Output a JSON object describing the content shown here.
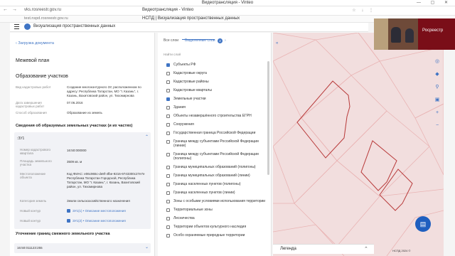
{
  "window": {
    "title": "Видеотрансляция - Vinteo",
    "controls": "— ▢ ✕"
  },
  "browser": {
    "nav": "← →",
    "url": "vks.rosreestr.gov.ru",
    "tab_center": "Видеотрансляция - Vinteo",
    "url2": "test.nspd.rosreestr.gov.ru",
    "page_title": "НСПД | Визуализация пространственных данных"
  },
  "app": {
    "name": "Визуализация пространственных данных"
  },
  "left": {
    "back": "Загрузка документа",
    "plan_title": "Межевой план",
    "section_title": "Образование участков",
    "fields": [
      {
        "label": "Вид кадастровых работ",
        "value": "Создание многоконтурного ЗУ, расположенном по адресу: Республика Татарстан, МО \"г. Казань\", г. Казань, Вахитовский район, ул. Тихомирнова"
      },
      {
        "label": "Дата завершения кадастровых работ",
        "value": "07.06.2016"
      },
      {
        "label": "Способ образования",
        "value": "Образование из земель"
      }
    ],
    "subsection": "Сведения об образуемых земельных участках (и их частях)",
    "card": {
      "id": ":ЗУ1",
      "rows": [
        {
          "label": "Номер кадастрового квартала",
          "value": "16:50:000000"
        },
        {
          "label": "Площадь земельного участка",
          "value": "3509 кв. м"
        },
        {
          "label": "Местоположение объекта",
          "value": "Код ФИАС: e06c965c-de8f-4fbe-9216-9743300c27e7e Республика Татарстан Городской, Республика Татарстан, МО \"г. Казань\", г. Казань, Вахитовский район, ул. Тихомирнова"
        },
        {
          "label": "Категория земель",
          "value": "Земли сельскохозяйственного назначения"
        },
        {
          "label": "Новый контур",
          "value": "ЗУ1(1) • Описание местоположения"
        },
        {
          "label": "Новый контур",
          "value": "ЗУ1(2) • Описание местоположения"
        }
      ]
    },
    "subsection2": "Уточнение границ смежного земельного участка",
    "card2_id": "16:50:011123:255"
  },
  "mid": {
    "tab_all": "Все слои",
    "tab_selected": "Выделенные слои",
    "badge": "2",
    "sub": "Найти слой",
    "layers": [
      {
        "name": "Субъекты РФ",
        "checked": true
      },
      {
        "name": "Кадастровые округа",
        "checked": false
      },
      {
        "name": "Кадастровые районы",
        "checked": false
      },
      {
        "name": "Кадастровые кварталы",
        "checked": false
      },
      {
        "name": "Земельные участки",
        "checked": true
      },
      {
        "name": "Здания",
        "checked": false
      },
      {
        "name": "Объекты незавершённого строительства ЕГРН",
        "checked": false
      },
      {
        "name": "Сооружения",
        "checked": false
      },
      {
        "name": "Государственная граница Российской Федерации",
        "checked": false
      },
      {
        "name": "Граница между субъектами Российской Федерации (линии)",
        "checked": false
      },
      {
        "name": "Граница между субъектами Российской Федерации (полигоны)",
        "checked": false
      },
      {
        "name": "Граница муниципальных образований (полигоны)",
        "checked": false
      },
      {
        "name": "Граница муниципальных образований (линии)",
        "checked": false
      },
      {
        "name": "Граница населенных пунктов (полигоны)",
        "checked": false
      },
      {
        "name": "Граница населенных пунктов (линии)",
        "checked": false
      },
      {
        "name": "Зоны с особыми условиями использования территории",
        "checked": false
      },
      {
        "name": "Территориальные зоны",
        "checked": false
      },
      {
        "name": "Лесничества",
        "checked": false
      },
      {
        "name": "Территории объектов культурного наследия",
        "checked": false
      },
      {
        "name": "Особо охраняемые природные территории",
        "checked": false
      }
    ]
  },
  "map": {
    "legend": "Легенда",
    "scale": "НСПД 2024 ©",
    "fab": "▤"
  },
  "video": {
    "brand": "Росреестр"
  }
}
